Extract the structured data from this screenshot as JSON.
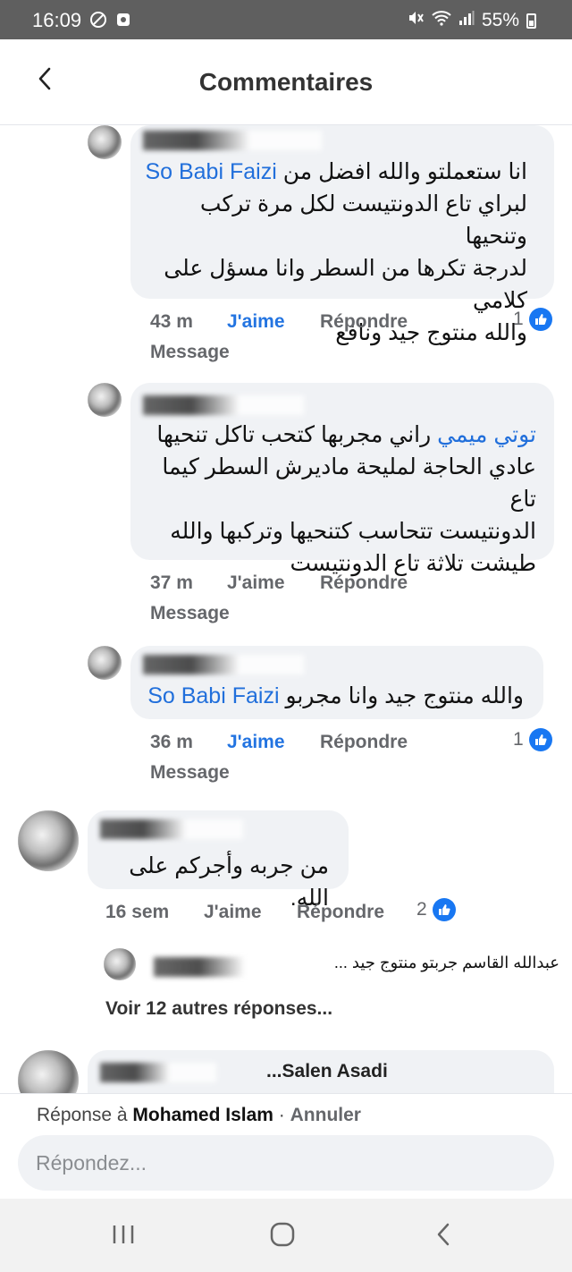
{
  "status_bar": {
    "time": "16:09",
    "battery": "55%"
  },
  "header": {
    "title": "Commentaires"
  },
  "comments": [
    {
      "mention": "So Babi Faizi",
      "lines": [
        "انا ستعملتو والله افضل من",
        "لبراي تاع الدونتيست لكل مرة تركب وتنحيها",
        "لدرجة تكرها من السطر وانا مسؤل على كلامي",
        "والله منتوج جيد ونافع"
      ],
      "time": "43 m",
      "like_label": "J'aime",
      "reply_label": "Répondre",
      "message_label": "Message",
      "reactions": "1"
    },
    {
      "mention": "توتي ميمي",
      "lines": [
        "راني مجربها كتحب تاكل تنحيها",
        "عادي الحاجة لمليحة ماديرش السطر كيما تاع",
        "الدونتيست تتحاسب كتنحيها وتركبها والله",
        "طيشت تلاثة تاع الدونتيست"
      ],
      "time": "37 m",
      "like_label": "J'aime",
      "reply_label": "Répondre",
      "message_label": "Message"
    },
    {
      "mention": "So Babi Faizi",
      "lines": [
        "والله منتوج جيد وانا مجربو"
      ],
      "time": "36 m",
      "like_label": "J'aime",
      "reply_label": "Répondre",
      "message_label": "Message",
      "reactions": "1"
    },
    {
      "lines": [
        "من جربه وأجركم على الله."
      ],
      "time": "16 sem",
      "like_label": "J'aime",
      "reply_label": "Répondre",
      "reactions": "2"
    }
  ],
  "reply_preview": {
    "text": "عبدالله القاسم جربتو منتوج جيد ..."
  },
  "more_replies": "Voir 12 autres réponses...",
  "last_comment": {
    "name_fragment": "...Salen Asadi"
  },
  "composer": {
    "replying_prefix": "Réponse à",
    "replying_to": "Mohamed Islam",
    "separator": " · ",
    "cancel_label": "Annuler",
    "placeholder": "Répondez..."
  },
  "icons": {
    "back": "chevron-left-icon",
    "like": "thumbs-up-icon",
    "recent": "recent-apps-icon",
    "home": "home-icon",
    "nav_back": "nav-back-icon"
  },
  "colors": {
    "accent": "#1877f2",
    "mention": "#216fdb",
    "bubble": "#f0f2f5"
  }
}
